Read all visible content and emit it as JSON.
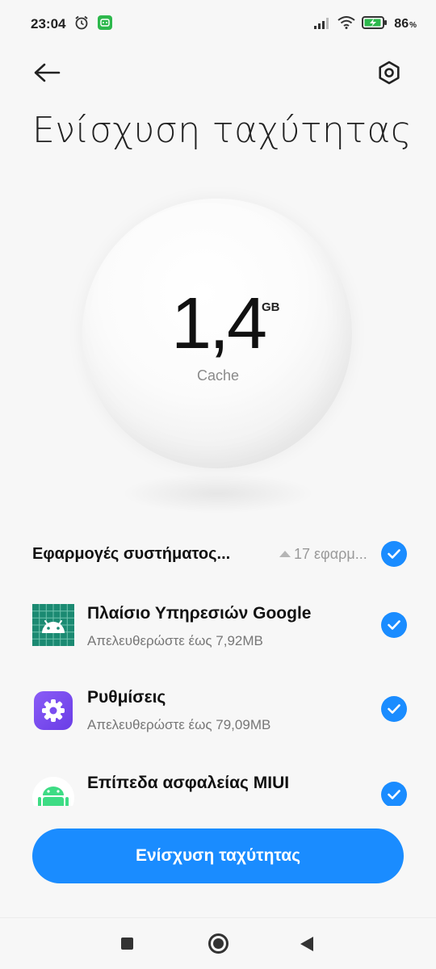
{
  "status_bar": {
    "time": "23:04",
    "battery_percent": "86",
    "battery_sign": "%",
    "icons": [
      "alarm-icon",
      "app-notification-icon",
      "signal-icon",
      "wifi-icon",
      "battery-charging-icon"
    ]
  },
  "header": {
    "back_icon": "arrow-left-icon",
    "settings_icon": "settings-hexagon-icon",
    "title": "Ενίσχυση ταχύτητας"
  },
  "summary": {
    "value": "1,4",
    "unit": "GB",
    "label": "Cache"
  },
  "group": {
    "title": "Εφαρμογές συστήματος...",
    "count": "17 εφαρμ...",
    "checked": true
  },
  "apps": [
    {
      "name": "Πλαίσιο Υπηρεσιών Google",
      "sub": "Απελευθερώστε έως 7,92MB",
      "icon": "android-grid-icon",
      "checked": true
    },
    {
      "name": "Ρυθμίσεις",
      "sub": "Απελευθερώστε έως 79,09MB",
      "icon": "settings-gear-icon",
      "checked": true
    },
    {
      "name": "Επίπεδα ασφαλείας MIUI",
      "sub": "",
      "icon": "android-robot-icon",
      "checked": true
    }
  ],
  "action": {
    "button_label": "Ενίσχυση ταχύτητας"
  },
  "colors": {
    "accent": "#1a8cff",
    "background": "#f7f7f7",
    "google_icon_bg": "#1b8a72",
    "settings_icon_bg": "#7a4df0"
  }
}
